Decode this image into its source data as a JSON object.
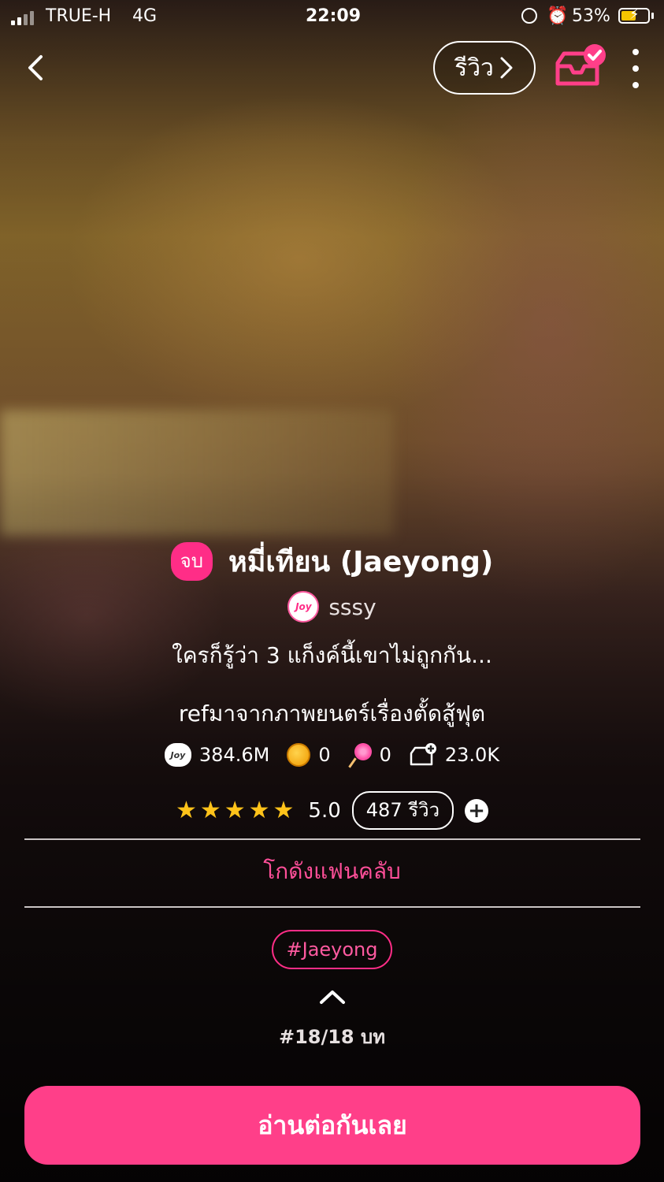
{
  "status_bar": {
    "carrier": "TRUE-H",
    "network": "4G",
    "time": "22:09",
    "battery_percent": "53%",
    "battery_level": 0.53,
    "battery_color": "#f5c400"
  },
  "nav": {
    "back_icon": "chevron-left-icon",
    "review_label": "รีวิว",
    "review_icon": "chevron-right-icon",
    "library_icon": "library-added-icon",
    "more_icon": "more-vertical-icon"
  },
  "story": {
    "status_badge": "จบ",
    "title": "หมี่เทียน (Jaeyong)",
    "author_avatar_text": "Joy",
    "author": "sssy",
    "tagline": "ใครก็รู้ว่า 3 แก็งค์นี้เขาไม่ถูกกัน...",
    "description": "refมาจากภาพยนตร์เรื่องตั้ดสู้ฟุต"
  },
  "stats": {
    "views_icon_text": "Joy",
    "views": "384.6M",
    "coins": "0",
    "candies": "0",
    "library_adds": "23.0K"
  },
  "rating": {
    "stars": "★★★★★",
    "stars_value": 5,
    "score": "5.0",
    "reviews": "487 รีวิว",
    "add_label": "+"
  },
  "fanclub_label": "โกดังแฟนคลับ",
  "hashtag": "#Jaeyong",
  "chapter_progress": "#18/18 บท",
  "read_button": "อ่านต่อกันเลย",
  "colors": {
    "accent": "#ff3f89",
    "badge": "#ff2d87",
    "star": "#ffc31a"
  }
}
